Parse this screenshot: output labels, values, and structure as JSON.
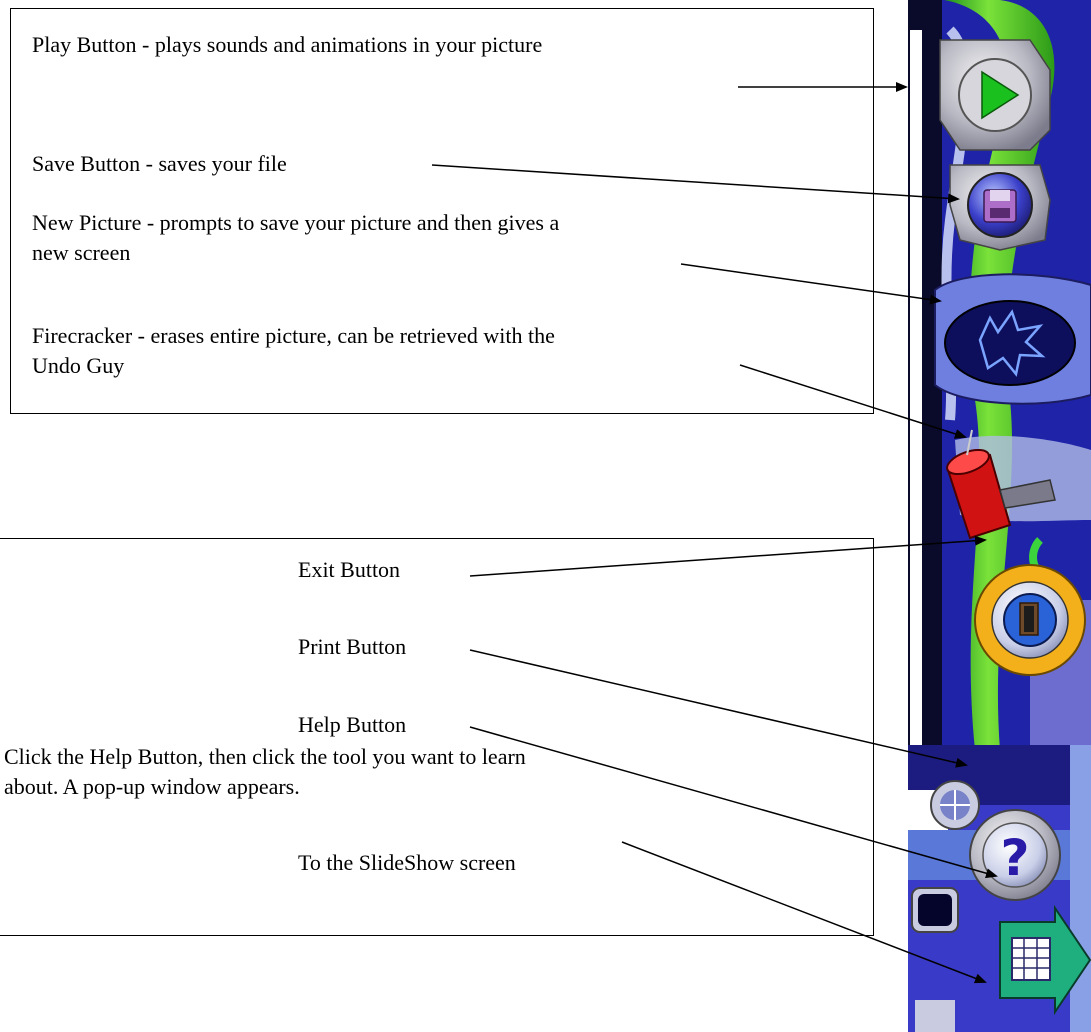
{
  "top_box": {
    "play": "Play Button - plays sounds and animations in your picture",
    "save": "Save Button - saves your file",
    "new_picture_line1": "New Picture - prompts to save your picture and then gives a",
    "new_picture_line2": "new screen",
    "firecracker_line1": "Firecracker - erases entire picture, can be retrieved with the",
    "firecracker_line2": "Undo Guy"
  },
  "bottom_box": {
    "exit": "Exit Button",
    "print": "Print Button",
    "help": "Help Button",
    "help_desc_line1": "Click the Help Button, then click the tool you want to learn",
    "help_desc_line2": "about.  A pop-up window appears.",
    "slideshow": "To the SlideShow screen"
  },
  "toolbar_icons": [
    "play-icon",
    "floppy-disk-icon",
    "new-picture-icon",
    "firecracker-icon",
    "exit-door-icon",
    "help-question-icon",
    "slideshow-arrow-icon"
  ]
}
